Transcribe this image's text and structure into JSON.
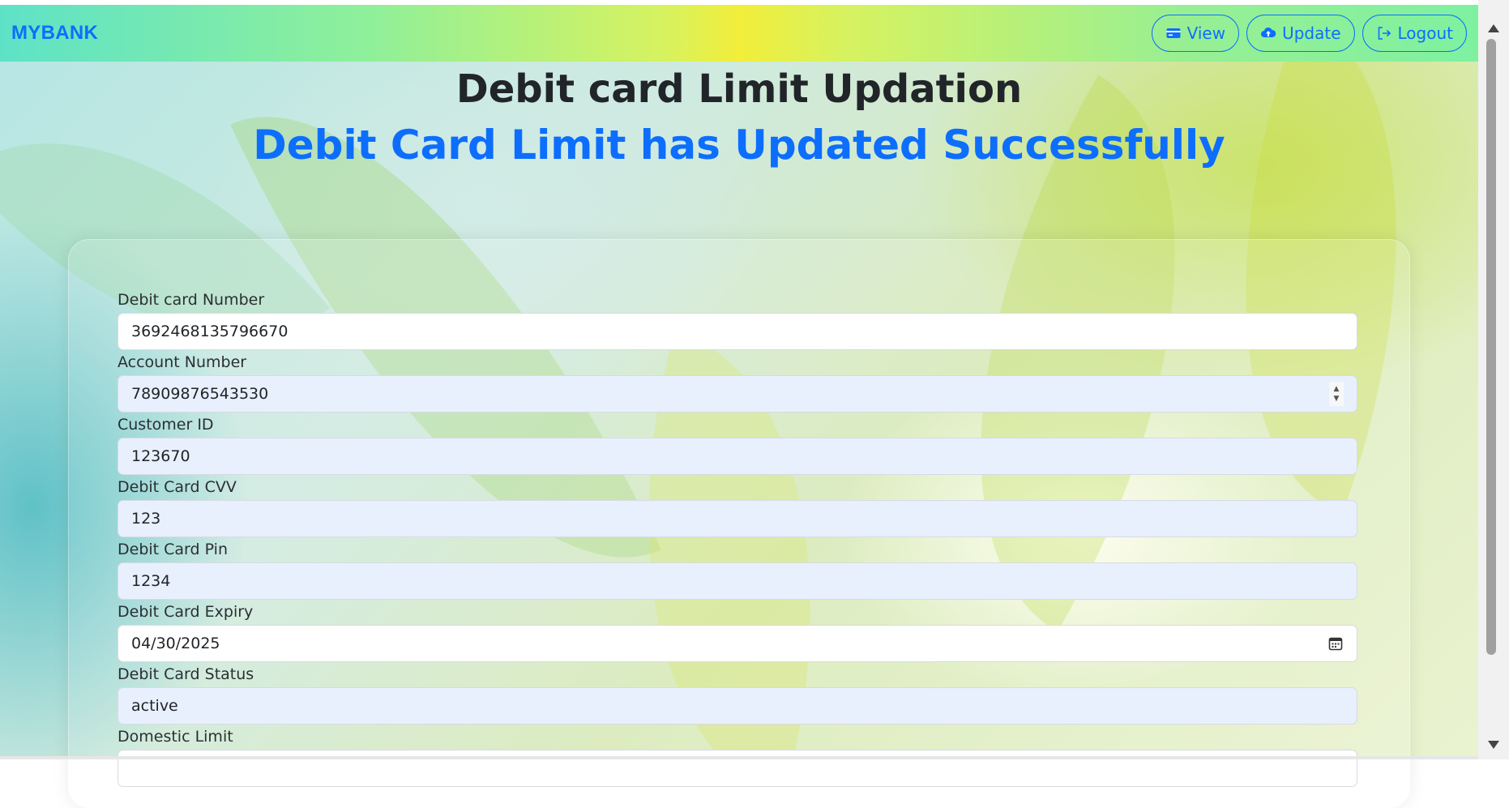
{
  "navbar": {
    "brand": "MYBANK",
    "buttons": [
      {
        "label": "View",
        "icon": "card-icon"
      },
      {
        "label": "Update",
        "icon": "cloud-upload-icon"
      },
      {
        "label": "Logout",
        "icon": "logout-icon"
      }
    ]
  },
  "header": {
    "title": "Debit card Limit Updation",
    "success_message": "Debit Card Limit has Updated Successfully"
  },
  "form": {
    "fields": [
      {
        "label": "Debit card Number",
        "value": "3692468135796670"
      },
      {
        "label": "Account Number",
        "value": "78909876543530"
      },
      {
        "label": "Customer ID",
        "value": "123670"
      },
      {
        "label": "Debit Card CVV",
        "value": "123"
      },
      {
        "label": "Debit Card Pin",
        "value": "1234"
      },
      {
        "label": "Debit Card Expiry",
        "value": "04/30/2025"
      },
      {
        "label": "Debit Card Status",
        "value": "active"
      },
      {
        "label": "Domestic Limit",
        "value": ""
      }
    ]
  },
  "colors": {
    "accent": "#0d6efd",
    "input_autofill_bg": "#e8f0fe"
  }
}
